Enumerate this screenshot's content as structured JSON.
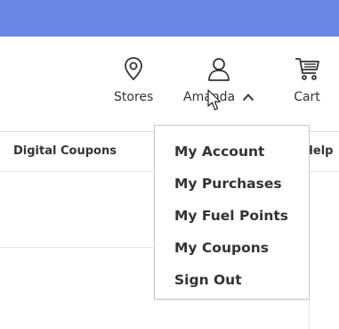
{
  "header": {
    "stores_label": "Stores",
    "account_label": "Amanda",
    "cart_label": "Cart"
  },
  "nav": {
    "digital_coupons": "Digital Coupons",
    "help": "Help"
  },
  "account_menu": {
    "items": [
      {
        "label": "My Account"
      },
      {
        "label": "My Purchases"
      },
      {
        "label": "My Fuel Points"
      },
      {
        "label": "My Coupons"
      },
      {
        "label": "Sign Out"
      }
    ]
  },
  "colors": {
    "banner": "#6b87e6",
    "text": "#333333",
    "border": "#c9c9c9"
  }
}
